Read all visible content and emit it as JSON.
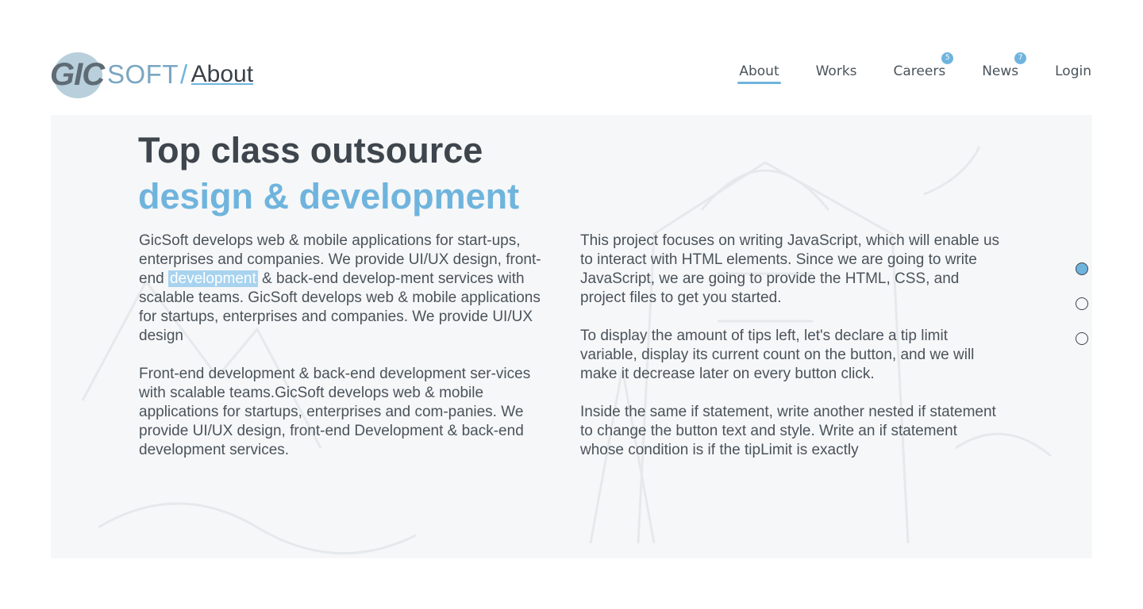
{
  "header": {
    "logo_mark": "GIC",
    "logo_soft": "SOFT",
    "logo_separator": "/",
    "page_name": "About",
    "nav": [
      {
        "label": "About",
        "badge": ""
      },
      {
        "label": "Works",
        "badge": ""
      },
      {
        "label": "Careers",
        "badge": "5"
      },
      {
        "label": "News",
        "badge": "7"
      },
      {
        "label": "Login",
        "badge": ""
      }
    ]
  },
  "hero": {
    "title_line1": "Top class outsource",
    "title_line2": "design & development"
  },
  "content": {
    "left_p1_a": "GicSoft develops web & mobile applications for start-ups, enterprises and companies. We provide UI/UX design, front-end ",
    "left_p1_highlight": "development",
    "left_p1_b": " & back-end develop-ment services with scalable teams. GicSoft develops web & mobile applications for startups, enterprises and companies. We provide UI/UX design",
    "left_p2": "Front-end development & back-end development ser-vices with scalable teams.GicSoft develops web & mobile applications for startups, enterprises and com-panies. We provide UI/UX design, front-end Development & back-end development services.",
    "right_p1": "This project focuses on writing JavaScript, which will enable us to interact with HTML elements. Since we are going to write JavaScript, we are going to provide the HTML, CSS, and project files to get you started.",
    "right_p2": "To display the amount of tips left, let's declare a tip limit variable, display its current count on the button, and we will make it decrease later on every button click.",
    "right_p3": "Inside the same if statement, write another nested if statement to change the button text and style. Write an if statement whose condition is if the tipLimit is exactly"
  },
  "pager": {
    "count": 3,
    "active_index": 0
  },
  "colors": {
    "accent": "#6fb4dd",
    "text": "#4a535b",
    "heading": "#3e454d"
  }
}
